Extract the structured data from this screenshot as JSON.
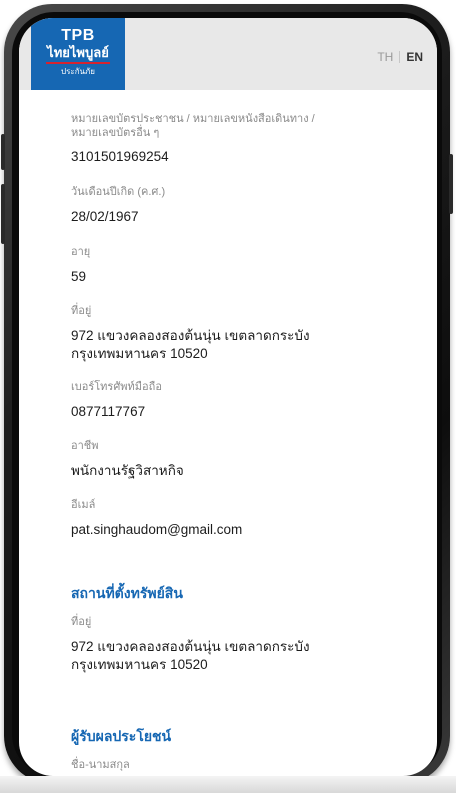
{
  "header": {
    "logo": {
      "line1": "TPB",
      "line2": "ไทยไพบูลย์",
      "line3": "ประกันภัย"
    },
    "lang_th": "TH",
    "lang_en": "EN"
  },
  "fields": [
    {
      "label_line1": "หมายเลขบัตรประชาชน / หมายเลขหนังสือเดินทาง /",
      "label_line2": "หมายเลขบัตรอื่น ๆ",
      "value": "3101501969254"
    },
    {
      "label": "วันเดือนปีเกิด (ค.ศ.)",
      "value": "28/02/1967"
    },
    {
      "label": "อายุ",
      "value": "59"
    },
    {
      "label": "ที่อยู่",
      "value_line1": "972 แขวงคลองสองต้นนุ่น เขตลาดกระบัง",
      "value_line2": "กรุงเทพมหานคร 10520"
    },
    {
      "label": "เบอร์โทรศัพท์มือถือ",
      "value": "0877117767"
    },
    {
      "label": "อาชีพ",
      "value": "พนักงานรัฐวิสาหกิจ"
    },
    {
      "label": "อีเมล์",
      "value": "pat.singhaudom@gmail.com"
    }
  ],
  "property_section": {
    "title": "สถานที่ตั้งทรัพย์สิน",
    "label": "ที่อยู่",
    "value_line1": "972 แขวงคลองสองต้นนุ่น เขตลาดกระบัง",
    "value_line2": "กรุงเทพมหานคร 10520"
  },
  "beneficiary_section": {
    "title": "ผู้รับผลประโยชน์",
    "label": "ชื่อ-นามสกุล"
  }
}
